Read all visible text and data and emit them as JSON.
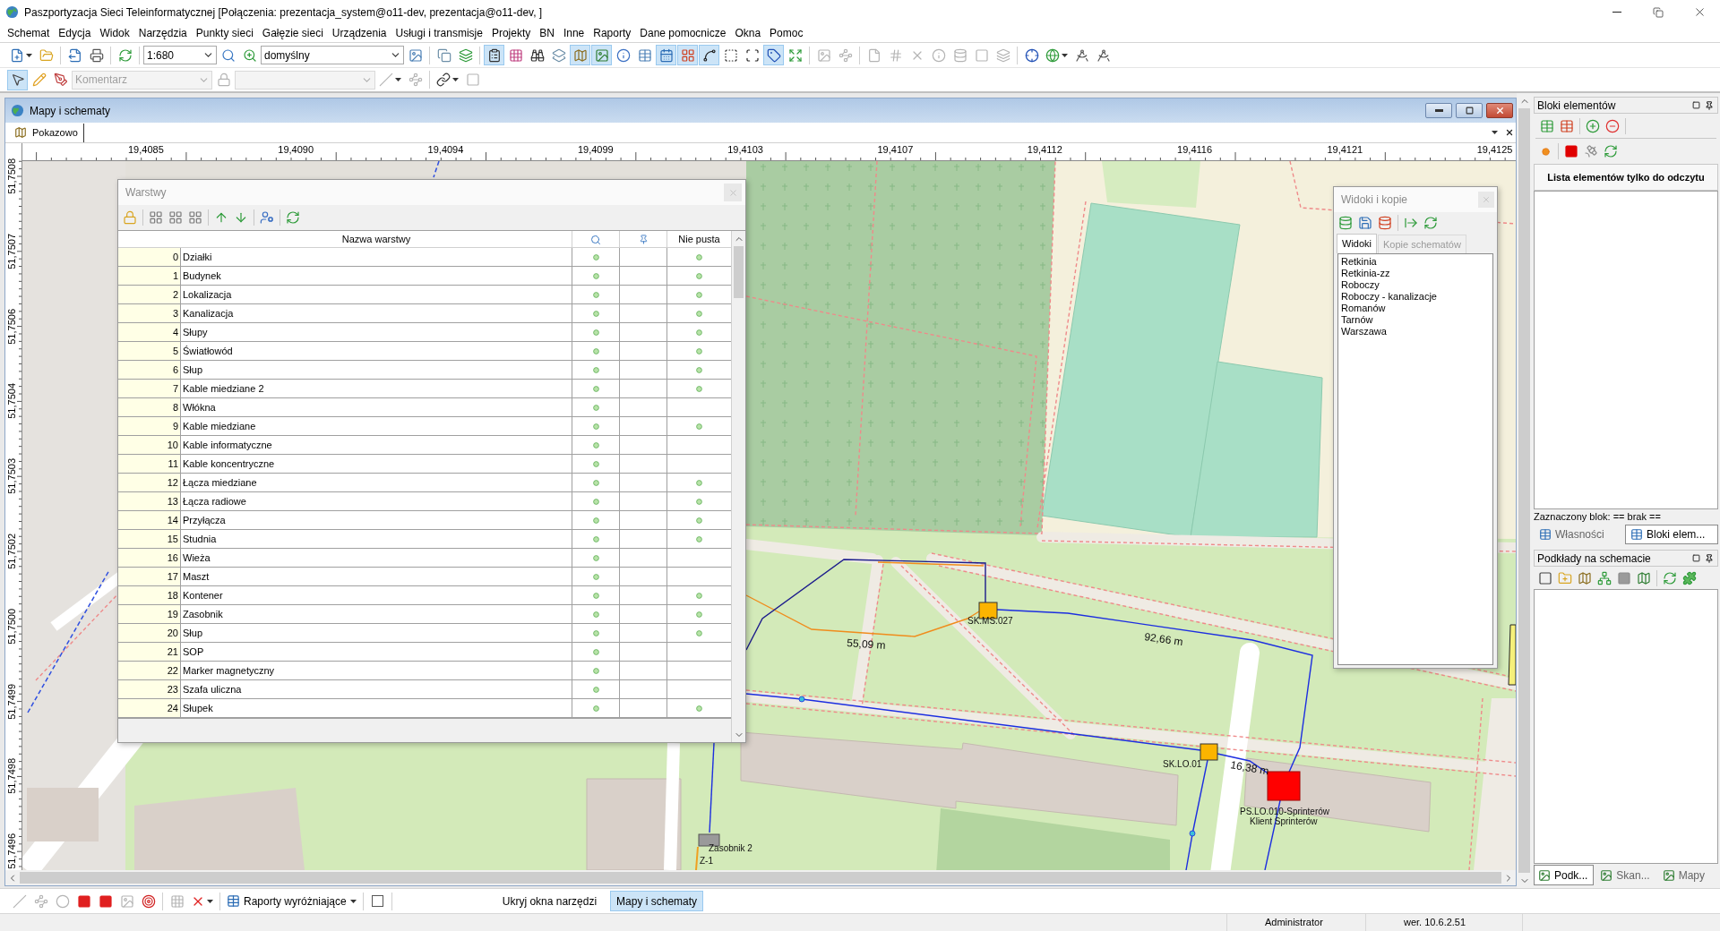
{
  "window": {
    "title": "Paszportyzacja Sieci Teleinformatycznej [Połączenia: prezentacja_system@o11-dev, prezentacja@o11-dev, ]"
  },
  "menu": [
    "Schemat",
    "Edycja",
    "Widok",
    "Narzędzia",
    "Punkty sieci",
    "Gałęzie sieci",
    "Urządzenia",
    "Usługi i transmisje",
    "Projekty",
    "BN",
    "Inne",
    "Raporty",
    "Dane pomocnicze",
    "Okna",
    "Pomoc"
  ],
  "toolbar_main": [
    {
      "kind": "menu_button",
      "pressed": false,
      "disabled": false
    },
    {
      "kind": "button",
      "pressed": false,
      "disabled": false
    },
    {
      "kind": "separator"
    },
    {
      "kind": "button",
      "pressed": false,
      "disabled": false
    },
    {
      "kind": "button",
      "pressed": false,
      "disabled": false
    },
    {
      "kind": "separator"
    },
    {
      "kind": "button",
      "pressed": false,
      "disabled": false
    },
    {
      "kind": "separator"
    },
    {
      "kind": "combo",
      "value": "1:680",
      "disabled": false
    },
    {
      "kind": "button",
      "pressed": false,
      "disabled": false
    },
    {
      "kind": "button",
      "pressed": false,
      "disabled": false
    },
    {
      "kind": "combo",
      "value": "domyślny",
      "disabled": false
    },
    {
      "kind": "button",
      "pressed": false,
      "disabled": false
    },
    {
      "kind": "separator"
    },
    {
      "kind": "button",
      "pressed": false,
      "disabled": false
    },
    {
      "kind": "button",
      "pressed": false,
      "disabled": false
    },
    {
      "kind": "separator"
    },
    {
      "kind": "button",
      "pressed": true,
      "disabled": false
    },
    {
      "kind": "button",
      "pressed": false,
      "disabled": false
    },
    {
      "kind": "button",
      "pressed": false,
      "disabled": false
    },
    {
      "kind": "button",
      "pressed": false,
      "disabled": false
    },
    {
      "kind": "button",
      "pressed": true,
      "disabled": false
    },
    {
      "kind": "button",
      "pressed": true,
      "disabled": false
    },
    {
      "kind": "button",
      "pressed": false,
      "disabled": false
    },
    {
      "kind": "button",
      "pressed": false,
      "disabled": false
    },
    {
      "kind": "button",
      "pressed": true,
      "disabled": false
    },
    {
      "kind": "button",
      "pressed": true,
      "disabled": false
    },
    {
      "kind": "button",
      "pressed": true,
      "disabled": false
    },
    {
      "kind": "button",
      "pressed": false,
      "disabled": false
    },
    {
      "kind": "button",
      "pressed": false,
      "disabled": false
    },
    {
      "kind": "button",
      "pressed": true,
      "disabled": false
    },
    {
      "kind": "button",
      "pressed": false,
      "disabled": false
    },
    {
      "kind": "separator"
    },
    {
      "kind": "button",
      "pressed": false,
      "disabled": true
    },
    {
      "kind": "button",
      "pressed": false,
      "disabled": true
    },
    {
      "kind": "separator"
    },
    {
      "kind": "button",
      "pressed": false,
      "disabled": true
    },
    {
      "kind": "button",
      "pressed": false,
      "disabled": true
    },
    {
      "kind": "button",
      "pressed": false,
      "disabled": true
    },
    {
      "kind": "button",
      "pressed": false,
      "disabled": true
    },
    {
      "kind": "button",
      "pressed": false,
      "disabled": true
    },
    {
      "kind": "button",
      "pressed": false,
      "disabled": true
    },
    {
      "kind": "button",
      "pressed": false,
      "disabled": true
    },
    {
      "kind": "separator"
    },
    {
      "kind": "button",
      "pressed": false,
      "disabled": false
    },
    {
      "kind": "menu_button",
      "pressed": false,
      "disabled": false
    },
    {
      "kind": "button",
      "pressed": false,
      "disabled": false
    },
    {
      "kind": "button",
      "pressed": false,
      "disabled": false
    }
  ],
  "toolbar_edit": [
    {
      "kind": "button",
      "pressed": true,
      "disabled": false
    },
    {
      "kind": "button",
      "pressed": false,
      "disabled": false
    },
    {
      "kind": "button",
      "pressed": false,
      "disabled": false
    },
    {
      "kind": "combo",
      "value": "Komentarz",
      "disabled": true
    },
    {
      "kind": "button",
      "pressed": false,
      "disabled": true
    },
    {
      "kind": "combo",
      "disabled": true
    },
    {
      "kind": "menu_button",
      "pressed": false,
      "disabled": true
    },
    {
      "kind": "button",
      "pressed": false,
      "disabled": true
    },
    {
      "kind": "separator"
    },
    {
      "kind": "menu_button",
      "pressed": false,
      "disabled": false
    },
    {
      "kind": "button",
      "pressed": false,
      "disabled": true
    }
  ],
  "workspace_window": {
    "title": "Mapy i schematy",
    "tabs": [
      {
        "label": "Pokazowo",
        "selected": true
      }
    ]
  },
  "ruler": {
    "x_labels": [
      "19,4085",
      "19,4090",
      "19,4094",
      "19,4099",
      "19,4103",
      "19,4107",
      "19,4112",
      "19,4116",
      "19,4121",
      "19,4125"
    ],
    "y_labels": [
      "51,7508",
      "51,7507",
      "51,7506",
      "51,7504",
      "51,7503",
      "51,7502",
      "51,7500",
      "51,7499",
      "51,7498",
      "51,7496"
    ]
  },
  "map": {
    "labels": [
      {
        "kind": "distance",
        "text": "55,09 m"
      },
      {
        "kind": "node",
        "text": "SK.MS.027"
      },
      {
        "kind": "distance",
        "text": "92,66 m"
      },
      {
        "kind": "node",
        "text": "SK.LO.01"
      },
      {
        "kind": "distance",
        "text": "16,38 m"
      },
      {
        "kind": "node",
        "text": "PS.LO.010-Sprinterów"
      },
      {
        "kind": "node",
        "text": "Klient Sprinterów"
      },
      {
        "kind": "node",
        "text": "Zasobnik 2"
      },
      {
        "kind": "node",
        "text": "Z-1"
      }
    ]
  },
  "layers_dialog": {
    "title": "Warstwy",
    "columns": {
      "name": "Nazwa warstwy",
      "non_empty": "Nie pusta"
    },
    "rows": [
      {
        "index": "0",
        "name": "Działki",
        "visible": true,
        "non_empty": true
      },
      {
        "index": "1",
        "name": "Budynek",
        "visible": true,
        "non_empty": true
      },
      {
        "index": "2",
        "name": "Lokalizacja",
        "visible": true,
        "non_empty": true
      },
      {
        "index": "3",
        "name": "Kanalizacja",
        "visible": true,
        "non_empty": true
      },
      {
        "index": "4",
        "name": "Słupy",
        "visible": true,
        "non_empty": true
      },
      {
        "index": "5",
        "name": "Światłowód",
        "visible": true,
        "non_empty": true
      },
      {
        "index": "6",
        "name": "Słup",
        "visible": true,
        "non_empty": true
      },
      {
        "index": "7",
        "name": "Kable miedziane 2",
        "visible": true,
        "non_empty": true
      },
      {
        "index": "8",
        "name": "Włókna",
        "visible": true,
        "non_empty": false
      },
      {
        "index": "9",
        "name": "Kable miedziane",
        "visible": true,
        "non_empty": true
      },
      {
        "index": "10",
        "name": "Kable informatyczne",
        "visible": true,
        "non_empty": false
      },
      {
        "index": "11",
        "name": "Kable koncentryczne",
        "visible": true,
        "non_empty": false
      },
      {
        "index": "12",
        "name": "Łącza miedziane",
        "visible": true,
        "non_empty": true
      },
      {
        "index": "13",
        "name": "Łącza radiowe",
        "visible": true,
        "non_empty": true
      },
      {
        "index": "14",
        "name": "Przyłącza",
        "visible": true,
        "non_empty": true
      },
      {
        "index": "15",
        "name": "Studnia",
        "visible": true,
        "non_empty": true
      },
      {
        "index": "16",
        "name": "Wieża",
        "visible": true,
        "non_empty": false
      },
      {
        "index": "17",
        "name": "Maszt",
        "visible": true,
        "non_empty": false
      },
      {
        "index": "18",
        "name": "Kontener",
        "visible": true,
        "non_empty": true
      },
      {
        "index": "19",
        "name": "Zasobnik",
        "visible": true,
        "non_empty": true
      },
      {
        "index": "20",
        "name": "Słup",
        "visible": true,
        "non_empty": true
      },
      {
        "index": "21",
        "name": "SOP",
        "visible": true,
        "non_empty": false
      },
      {
        "index": "22",
        "name": "Marker magnetyczny",
        "visible": true,
        "non_empty": false
      },
      {
        "index": "23",
        "name": "Szafa uliczna",
        "visible": true,
        "non_empty": false
      },
      {
        "index": "24",
        "name": "Słupek",
        "visible": true,
        "non_empty": true
      }
    ]
  },
  "views_dialog": {
    "title": "Widoki i kopie",
    "tabs": [
      {
        "label": "Widoki",
        "selected": true
      },
      {
        "label": "Kopie schematów",
        "selected": false
      }
    ],
    "items": [
      "Retkinia",
      "Retkinia-zz",
      "Roboczy",
      "Roboczy - kanalizacje",
      "Romanów",
      "Tarnów",
      "Warszawa"
    ]
  },
  "blocks_panel": {
    "title": "Bloki elementów",
    "list_header": "Lista elementów tylko do odczytu",
    "selection": "Zaznaczony blok: == brak ==",
    "tabs": [
      {
        "label": "Własności",
        "selected": false
      },
      {
        "label": "Bloki elem...",
        "selected": true
      }
    ]
  },
  "underlays_panel": {
    "title": "Podkłady na schemacie",
    "tabs": [
      {
        "label": "Podk...",
        "selected": true
      },
      {
        "label": "Skan...",
        "selected": false
      },
      {
        "label": "Mapy",
        "selected": false
      }
    ]
  },
  "bottom_toolbar": {
    "tools": [
      {
        "kind": "button",
        "pressed": false,
        "disabled": true
      },
      {
        "kind": "button",
        "pressed": false,
        "disabled": true
      },
      {
        "kind": "button",
        "pressed": false,
        "disabled": true
      },
      {
        "kind": "button",
        "pressed": false,
        "disabled": false
      },
      {
        "kind": "button",
        "pressed": false,
        "disabled": false
      },
      {
        "kind": "button",
        "pressed": false,
        "disabled": true
      },
      {
        "kind": "button",
        "pressed": false,
        "disabled": false
      },
      {
        "kind": "separator"
      },
      {
        "kind": "button",
        "pressed": false,
        "disabled": true
      },
      {
        "kind": "menu_button",
        "pressed": false,
        "disabled": false
      },
      {
        "kind": "separator"
      },
      {
        "kind": "text_menu",
        "label": "Raporty wyróżniające"
      },
      {
        "kind": "separator"
      },
      {
        "kind": "checkbox",
        "checked": false
      },
      {
        "kind": "separator"
      }
    ],
    "window_buttons": [
      {
        "label": "Ukryj okna narzędzi",
        "selected": false
      },
      {
        "label": "Mapy i schematy",
        "selected": true
      }
    ]
  },
  "status_bar": [
    "Administrator",
    "wer. 10.6.2.51"
  ]
}
